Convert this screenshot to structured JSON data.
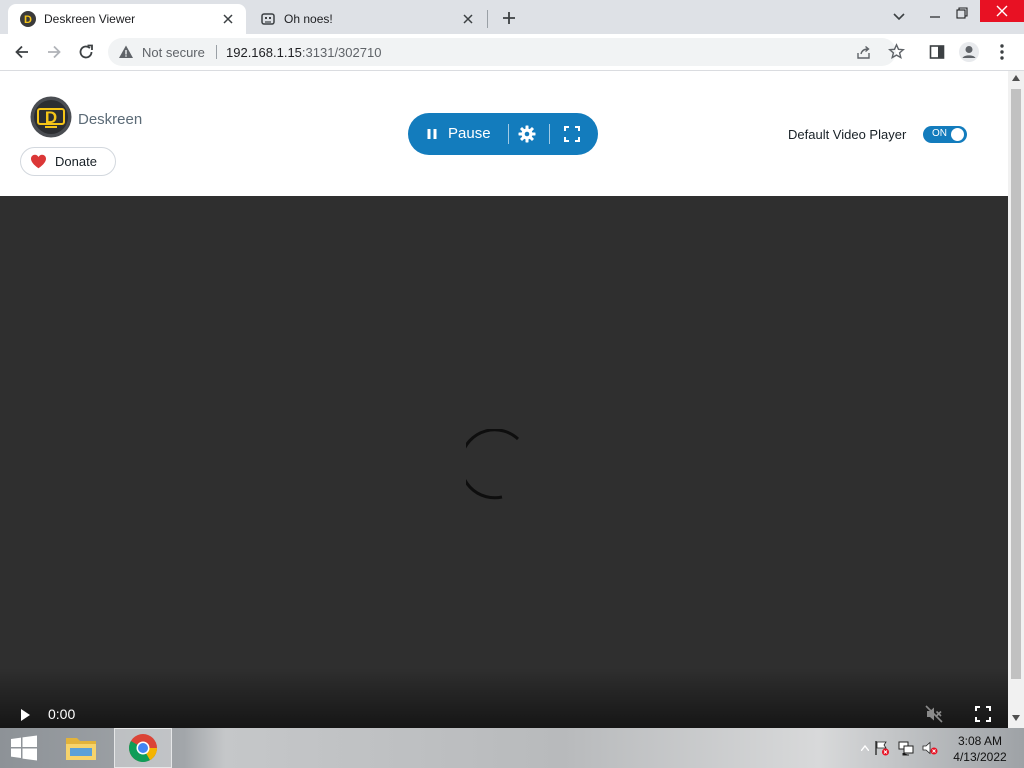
{
  "browser": {
    "tabs": [
      {
        "title": "Deskreen Viewer",
        "active": true,
        "icon": "deskreen-favicon"
      },
      {
        "title": "Oh noes!",
        "active": false,
        "icon": "broken-robot-favicon"
      }
    ],
    "address": {
      "security_label": "Not secure",
      "url_host": "192.168.1.15",
      "url_rest": ":3131/302710"
    }
  },
  "header": {
    "brand": "Deskreen",
    "donate_label": "Donate",
    "pause_label": "Pause",
    "default_player_label": "Default Video Player",
    "toggle_label": "ON",
    "toggle_state": true
  },
  "video": {
    "time": "0:00",
    "muted": true,
    "loading": true
  },
  "taskbar": {
    "time": "3:08 AM",
    "date": "4/13/2022"
  },
  "colors": {
    "accent": "#137cbd",
    "video_bg": "#2f2f2f",
    "heart": "#db3737"
  }
}
